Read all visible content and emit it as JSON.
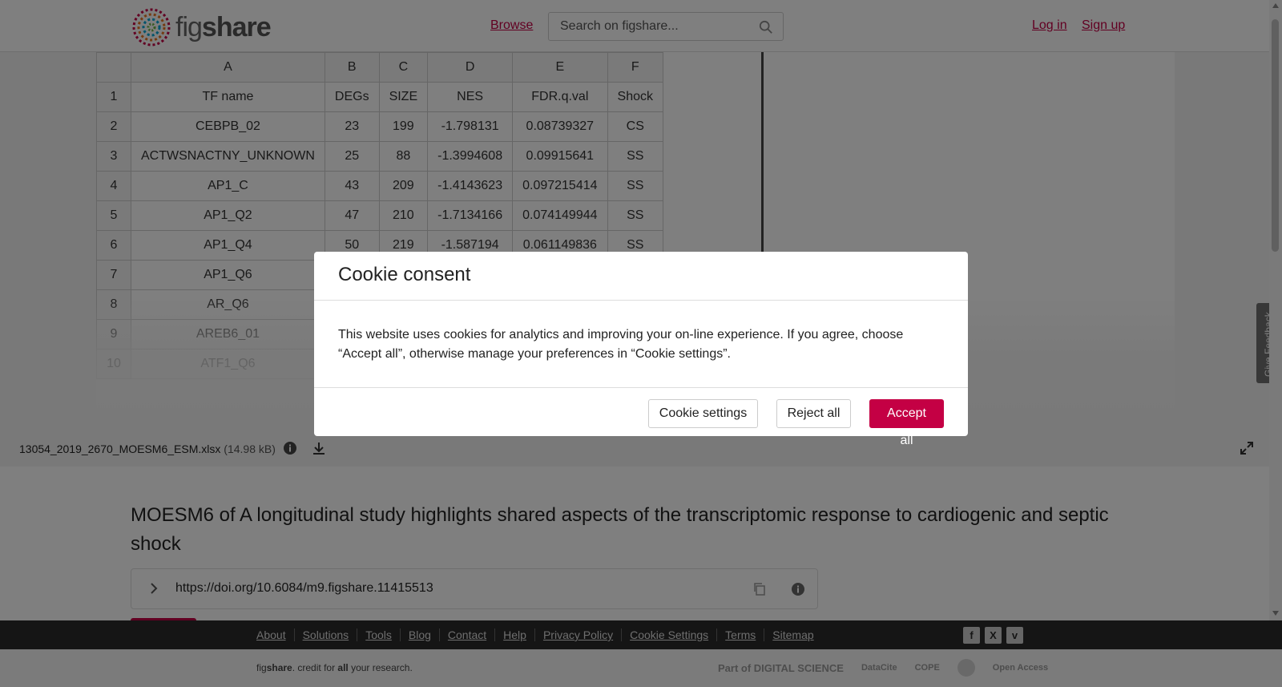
{
  "header": {
    "logo_text_fig": "fig",
    "logo_text_share": "share",
    "browse_label": "Browse",
    "search_placeholder": "Search on figshare...",
    "login_label": "Log in",
    "signup_label": "Sign up"
  },
  "spreadsheet": {
    "column_headers": [
      "A",
      "B",
      "C",
      "D",
      "E",
      "F"
    ],
    "rows": [
      {
        "num": "1",
        "cells": [
          "TF name",
          "DEGs",
          "SIZE",
          "NES",
          "FDR.q.val",
          "Shock"
        ]
      },
      {
        "num": "2",
        "cells": [
          "CEBPB_02",
          "23",
          "199",
          "-1.798131",
          "0.08739327",
          "CS"
        ]
      },
      {
        "num": "3",
        "cells": [
          "ACTWSNACTNY_UNKNOWN",
          "25",
          "88",
          "-1.3994608",
          "0.09915641",
          "SS"
        ]
      },
      {
        "num": "4",
        "cells": [
          "AP1_C",
          "43",
          "209",
          "-1.4143623",
          "0.097215414",
          "SS"
        ]
      },
      {
        "num": "5",
        "cells": [
          "AP1_Q2",
          "47",
          "210",
          "-1.7134166",
          "0.074149944",
          "SS"
        ]
      },
      {
        "num": "6",
        "cells": [
          "AP1_Q4",
          "50",
          "219",
          "-1.587194",
          "0.061149836",
          "SS"
        ]
      },
      {
        "num": "7",
        "cells": [
          "AP1_Q6",
          "",
          "",
          "",
          "",
          ""
        ]
      },
      {
        "num": "8",
        "cells": [
          "AR_Q6",
          "",
          "",
          "",
          "",
          ""
        ]
      },
      {
        "num": "9",
        "cells": [
          "AREB6_01",
          "",
          "",
          "",
          "",
          ""
        ]
      },
      {
        "num": "10",
        "cells": [
          "ATF1_Q6",
          "",
          "",
          "",
          "",
          ""
        ]
      }
    ]
  },
  "file": {
    "name": "13054_2019_2670_MOESM6_ESM.xlsx",
    "size": "(14.98 kB)"
  },
  "feedback_label": "Give Feedback",
  "article": {
    "title": "MOESM6 of A longitudinal study highlights shared aspects of the transcriptomic response to cardiogenic and septic shock",
    "doi_url": "https://doi.org/10.6084/m9.figshare.11415513"
  },
  "footer": {
    "links": [
      "About",
      "Solutions",
      "Tools",
      "Blog",
      "Contact",
      "Help",
      "Privacy Policy",
      "Cookie Settings",
      "Terms",
      "Sitemap"
    ],
    "tagline_fig": "fig",
    "tagline_share": "share",
    "tagline_rest_1": ". credit for ",
    "tagline_all": "all",
    "tagline_rest_2": " your research.",
    "partners": [
      "Part of DIGITAL SCIENCE",
      "DataCite",
      "COPE",
      "Open Access"
    ]
  },
  "cookie_modal": {
    "title": "Cookie consent",
    "body": "This website uses cookies for analytics and improving your on-line experience. If you agree, choose “Accept all”, otherwise manage your preferences in “Cookie settings”.",
    "settings_label": "Cookie settings",
    "reject_label": "Reject all",
    "accept_label": "Accept all"
  },
  "colors": {
    "brand": "#c40044",
    "footer_bg": "#2a2a2a"
  }
}
